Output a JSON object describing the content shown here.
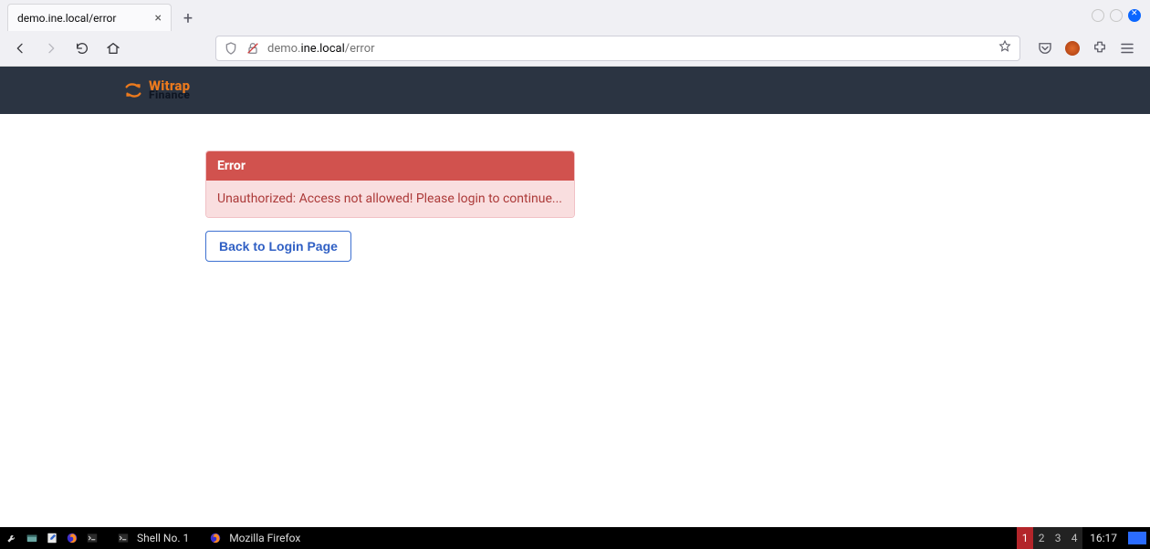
{
  "browser": {
    "tab_title": "demo.ine.local/error",
    "url_prefix": "demo.",
    "url_host": "ine.local",
    "url_path": "/error"
  },
  "brand": {
    "line1": "Witrap",
    "line2": "Finance"
  },
  "alert": {
    "title": "Error",
    "message": "Unauthorized: Access not allowed! Please login to continue..."
  },
  "actions": {
    "back_to_login": "Back to Login Page"
  },
  "taskbar": {
    "app1": "Shell No. 1",
    "app2": "Mozilla Firefox",
    "workspaces": [
      "1",
      "2",
      "3",
      "4"
    ],
    "active_workspace": 0,
    "clock": "16:17"
  }
}
